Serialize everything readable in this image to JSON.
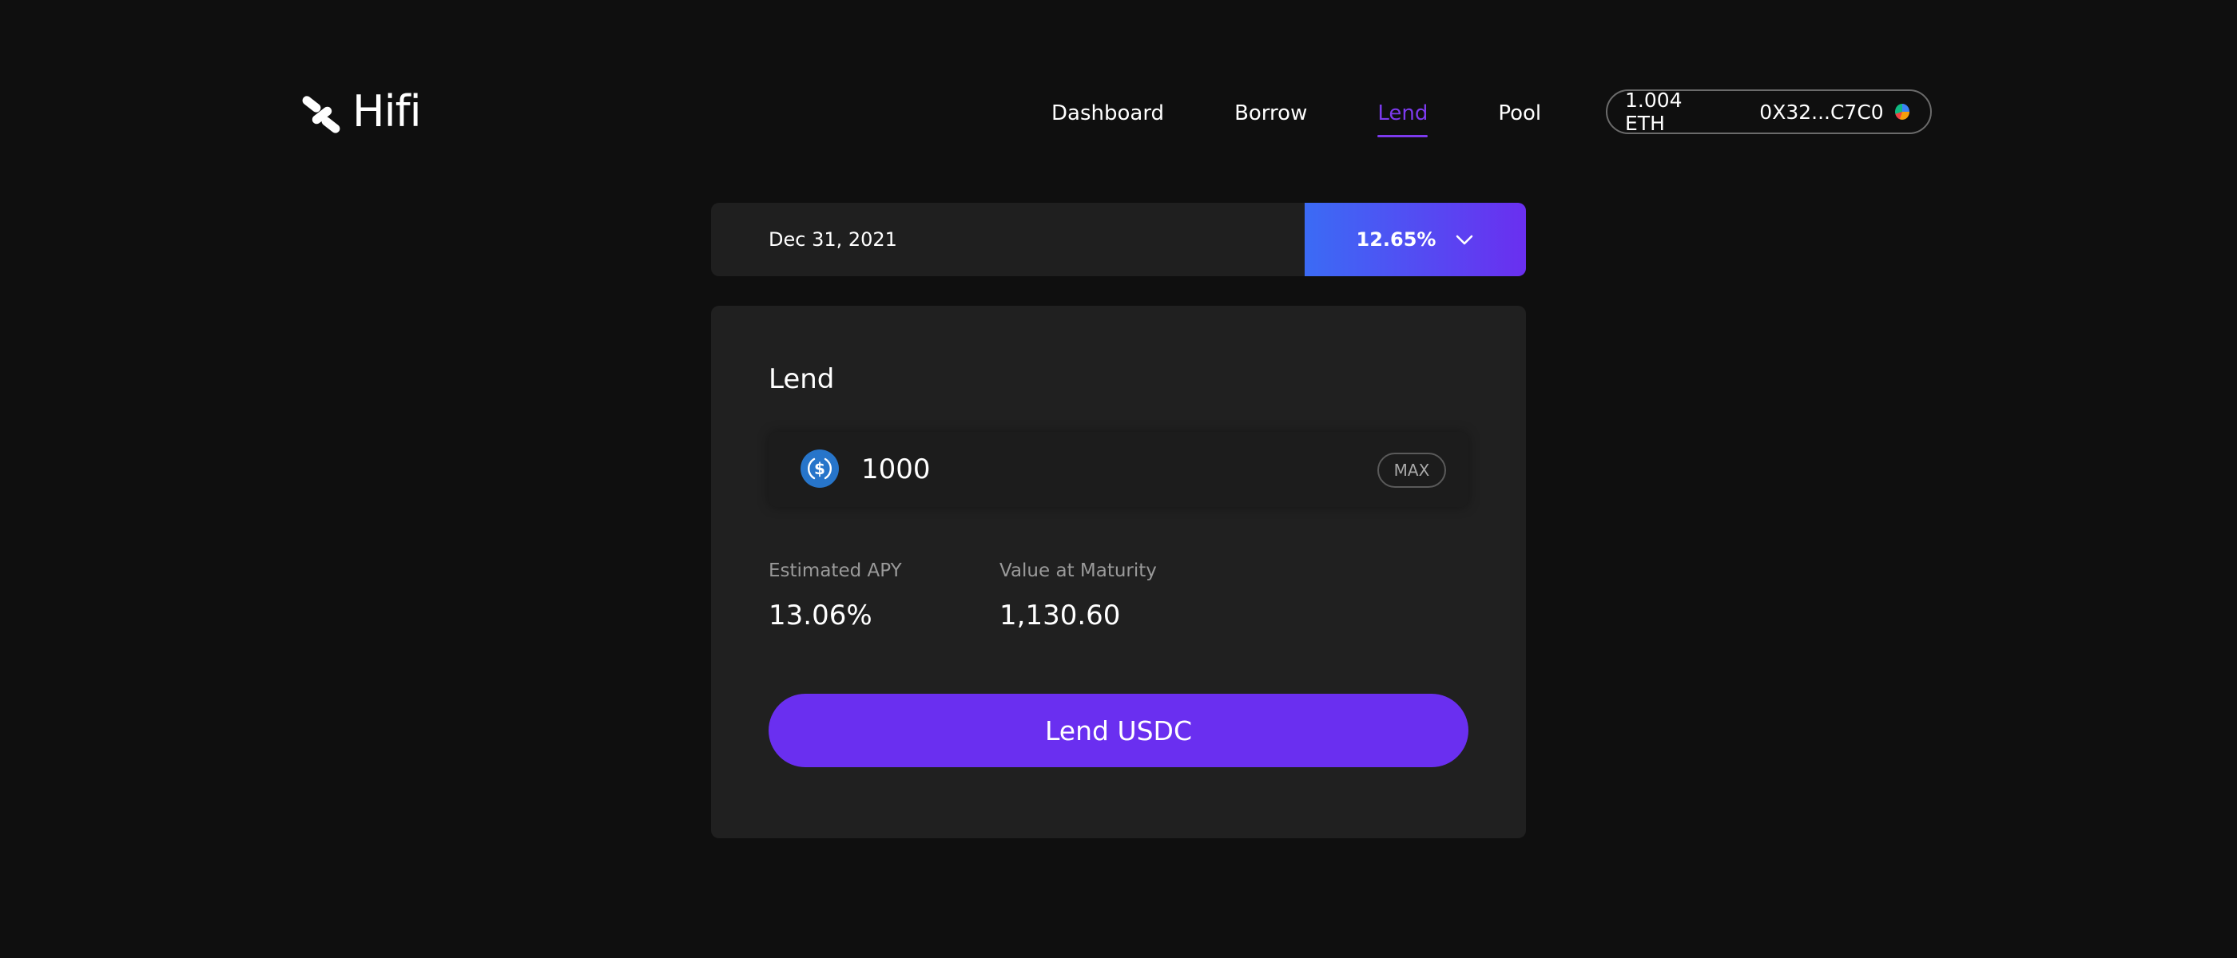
{
  "brand": {
    "name": "Hifi",
    "logo_icon": "hifi-logo-icon"
  },
  "nav": {
    "items": [
      {
        "label": "Dashboard",
        "active": false
      },
      {
        "label": "Borrow",
        "active": false
      },
      {
        "label": "Lend",
        "active": true
      },
      {
        "label": "Pool",
        "active": false
      }
    ]
  },
  "wallet": {
    "balance": "1.004 ETH",
    "address": "0X32...C7C0",
    "avatar_icon": "wallet-avatar-icon"
  },
  "maturity": {
    "date": "Dec 31, 2021",
    "rate": "12.65%",
    "dropdown_icon": "chevron-down-icon"
  },
  "lend": {
    "title": "Lend",
    "token_icon": "usdc-icon",
    "amount": "1000",
    "max_label": "MAX",
    "estimated_apy_label": "Estimated APY",
    "estimated_apy_value": "13.06%",
    "value_at_maturity_label": "Value at Maturity",
    "value_at_maturity_value": "1,130.60",
    "submit_label": "Lend USDC"
  },
  "colors": {
    "background": "#0f0f0f",
    "card": "#202020",
    "accent": "#6a2ff0",
    "active_nav": "#7c3aed",
    "gradient_start": "#3b6bf5",
    "gradient_end": "#6a2ff0",
    "usdc_blue": "#2775ca"
  }
}
